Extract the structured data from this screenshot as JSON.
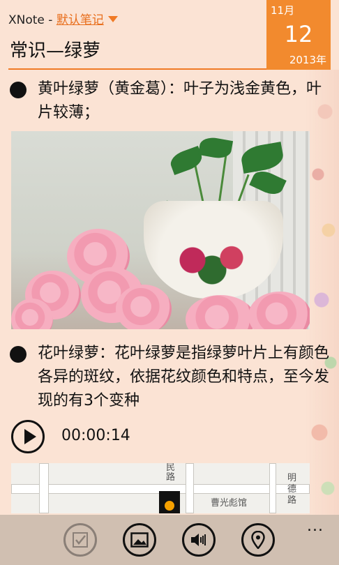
{
  "header": {
    "app_name": "XNote - ",
    "notebook": "默认笔记",
    "title": "常识—绿萝",
    "date": {
      "month": "11月",
      "day": "12",
      "year": "2013年"
    }
  },
  "content": {
    "bullet1": "黄叶绿萝（黄金葛）：叶子为浅金黄色，叶片较薄；",
    "bullet2": "花叶绿萝：花叶绿萝是指绿萝叶片上有颜色各异的斑纹，依据花纹颜色和特点，至今发现的有3个变种"
  },
  "audio": {
    "time": "00:00:14"
  },
  "map": {
    "labels": {
      "road1": "民路",
      "road2": "明德路",
      "place": "曹光彪馆"
    }
  },
  "appbar": {
    "buttons": [
      "checkbox-icon",
      "image-icon",
      "audio-icon",
      "location-icon"
    ],
    "more": "..."
  },
  "colors": {
    "accent": "#f28a2e",
    "background": "#fbe3d4"
  }
}
